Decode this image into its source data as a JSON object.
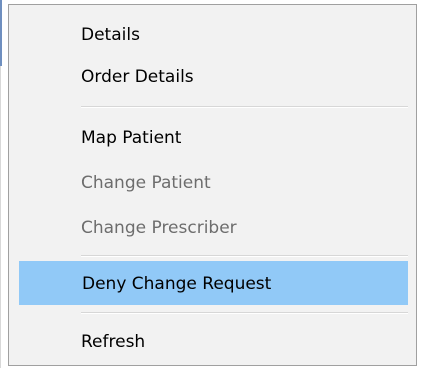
{
  "context_menu": {
    "items": [
      {
        "label": "Details",
        "enabled": true,
        "highlighted": false
      },
      {
        "label": "Order Details",
        "enabled": true,
        "highlighted": false
      },
      {
        "label": "Map Patient",
        "enabled": true,
        "highlighted": false
      },
      {
        "label": "Change Patient",
        "enabled": false,
        "highlighted": false
      },
      {
        "label": "Change Prescriber",
        "enabled": false,
        "highlighted": false
      },
      {
        "label": "Deny Change Request",
        "enabled": true,
        "highlighted": true
      },
      {
        "label": "Refresh",
        "enabled": true,
        "highlighted": false
      }
    ]
  },
  "colors": {
    "menu_background": "#f2f2f2",
    "highlight": "#91c9f7",
    "disabled_text": "#6d6d6d"
  }
}
